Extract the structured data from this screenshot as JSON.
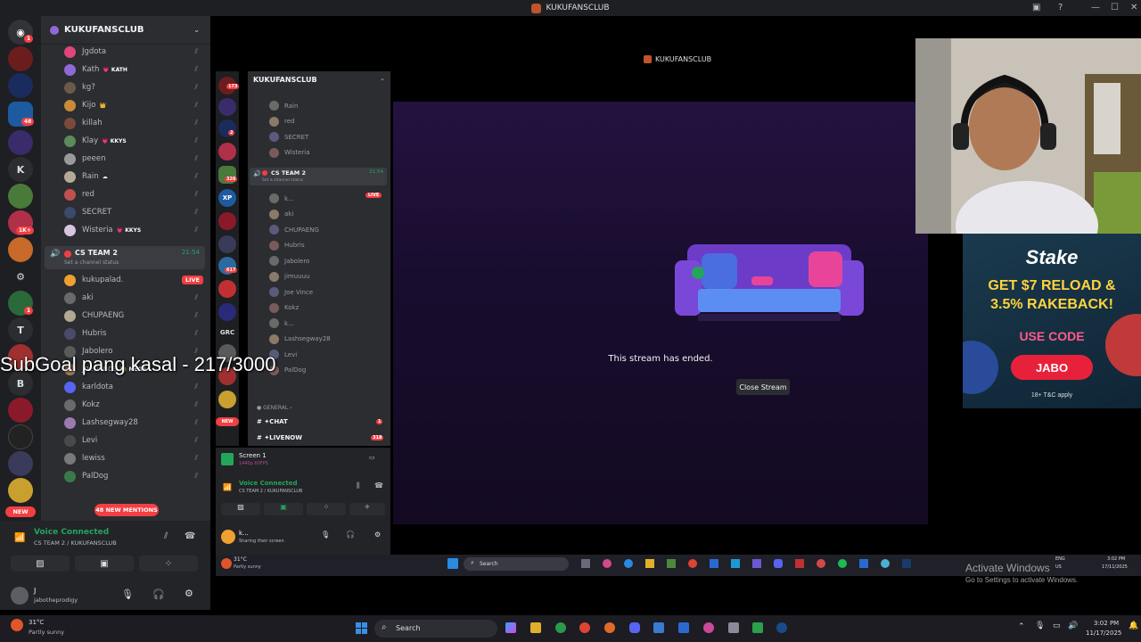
{
  "window": {
    "title": "KUKUFANSCLUB",
    "controls": [
      "—",
      "☐",
      "✕"
    ]
  },
  "servers": {
    "badges": [
      "1",
      "48",
      "1",
      "1K+",
      "1"
    ],
    "letters": [
      "K",
      "T",
      "B"
    ],
    "new_label": "NEW"
  },
  "sidebar": {
    "server_name": "KUKUFANSCLUB",
    "members_top": [
      {
        "name": "Jgdota",
        "color": "#e0457b",
        "tag": ""
      },
      {
        "name": "Kath",
        "color": "#8e6ad6",
        "tag": "💗 KATH"
      },
      {
        "name": "kg?",
        "color": "#6b5a48",
        "tag": ""
      },
      {
        "name": "Kijo",
        "color": "#c98a3a",
        "tag": "👑"
      },
      {
        "name": "killah",
        "color": "#7a4a3a",
        "tag": ""
      },
      {
        "name": "Klay",
        "color": "#5c8a5c",
        "tag": "💗 KKYS"
      },
      {
        "name": "peeen",
        "color": "#9a9a9a",
        "tag": ""
      },
      {
        "name": "Rain",
        "color": "#b5aa98",
        "tag": "☁"
      },
      {
        "name": "red",
        "color": "#c05050",
        "tag": ""
      },
      {
        "name": "SECRET",
        "color": "#3b4a6a",
        "tag": ""
      },
      {
        "name": "Wisteria",
        "color": "#d9c4e0",
        "tag": "💗 KKYS"
      }
    ],
    "voice_channel": {
      "name": "CS TEAM 2",
      "time": "21:54",
      "status": "Set a channel status"
    },
    "members_voice": [
      {
        "name": "kukupalad.",
        "color": "#f0a030",
        "live": "LIVE"
      },
      {
        "name": "aki",
        "color": "#6a6a6a"
      },
      {
        "name": "CHUPAENG",
        "color": "#b0a890"
      },
      {
        "name": "Hubris",
        "color": "#4a4a6a"
      },
      {
        "name": "Jabolero",
        "color": "#5a5a5a"
      },
      {
        "name": "Joe Vince",
        "color": "#a07a5a",
        "tag": "🟢 MEGA"
      },
      {
        "name": "karldota",
        "color": "#5865f2"
      },
      {
        "name": "Kokz",
        "color": "#6a6a6a"
      },
      {
        "name": "Lashsegway28",
        "color": "#9a7ab0"
      },
      {
        "name": "Levi",
        "color": "#4a4a4a"
      },
      {
        "name": "lewiss",
        "color": "#7a7a7a"
      },
      {
        "name": "PalDog",
        "color": "#3a7a4a"
      }
    ],
    "mentions_label": "48 NEW MENTIONS",
    "general_label": "GENERAL"
  },
  "voice_bar": {
    "title": "Voice Connected",
    "subtitle": "CS TEAM 2 / KUKUFANSCLUB",
    "user_name": "J",
    "user_handle": "jabotheprodigy"
  },
  "overlay": {
    "text": "SubGoal pang kasal - 217/3000"
  },
  "inner": {
    "title": "KUKUFANSCLUB",
    "badges": [
      "173",
      "2",
      "326",
      "617",
      "NEW"
    ],
    "grc_label": "GRC",
    "server_name": "KUKUFANSCLUB",
    "members_top": [
      "Rain",
      "red",
      "SECRET",
      "Wisteria"
    ],
    "voice_channel": {
      "name": "CS TEAM 2",
      "time": "21:54",
      "status": "Set a channel status"
    },
    "members_voice": [
      "k...",
      "aki",
      "CHUPAENG",
      "Hubris",
      "Jabolero",
      "jimuuuu",
      "Joe Vince",
      "Kokz",
      "k...",
      "Lashsegway28",
      "Levi",
      "PalDog"
    ],
    "live_label": "LIVE",
    "general_label": "GENERAL",
    "channel_chat": "✦CHAT",
    "channel_chat_badge": "1",
    "channel_livenow": "✦LIVENOW",
    "channel_livenow_badge": "318",
    "screen_label": "Screen 1",
    "screen_sub": "1440p 60FPS",
    "voice_title": "Voice Connected",
    "voice_sub": "CS TEAM 2 / KUKUFANSCLUB",
    "user_name": "k...",
    "user_status": "Sharing their screen",
    "stream_ended": "This stream has ended.",
    "close_stream": "Close Stream",
    "weather_temp": "31°C",
    "weather_desc": "Partly sunny",
    "search_label": "Search",
    "lang": "ENG",
    "region": "US",
    "time": "3:02 PM",
    "date": "17/11/2025",
    "activate_title": "Activate Windows",
    "activate_sub": "Go to Settings to activate Windows."
  },
  "ad": {
    "brand": "Stake",
    "headline1": "GET $7 RELOAD &",
    "headline2": "3.5% RAKEBACK!",
    "use_code": "USE CODE",
    "code": "JABO",
    "disclaimer": "18+ T&C apply"
  },
  "taskbar": {
    "weather_temp": "31°C",
    "weather_desc": "Partly sunny",
    "search_label": "Search",
    "time": "3:02 PM",
    "date": "11/17/2025"
  }
}
